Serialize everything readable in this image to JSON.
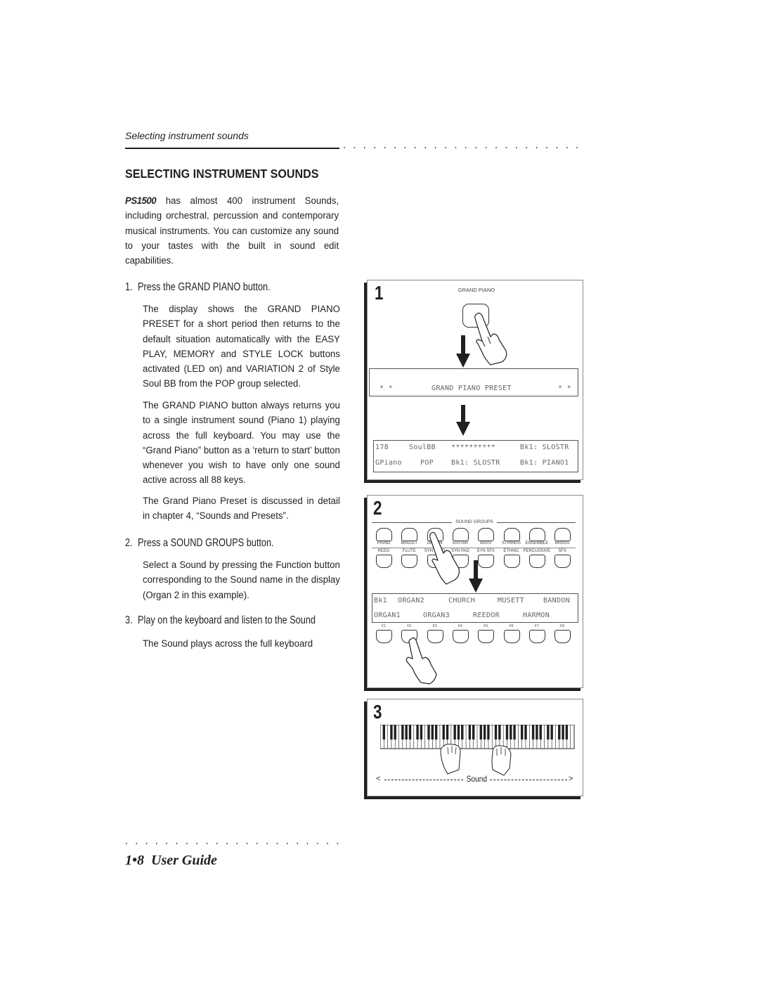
{
  "header": {
    "running_head": "Selecting instrument sounds"
  },
  "section": {
    "title": "SELECTING INSTRUMENT SOUNDS",
    "brand": "PS1500",
    "intro": " has almost 400 instrument Sounds, including orchestral, percussion and contemporary musical instruments.  You can customize any sound to your tastes with the built in sound edit capabilities."
  },
  "steps": [
    {
      "number": "1.",
      "title": "Press the GRAND PIANO button.",
      "paragraphs": [
        "The display shows the GRAND PIANO PRESET for a short period then returns to the default situation automatically with the EASY PLAY, MEMORY and STYLE LOCK buttons activated (LED on) and VARIATION 2 of Style Soul BB from the POP group selected.",
        "The GRAND PIANO button always returns you to a single instrument sound (Piano 1) playing across the full keyboard.  You may use the “Grand Piano” button as a ‘return to start’ button whenever you wish to have only one sound active across all 88 keys.",
        "The Grand Piano Preset is discussed in detail in chapter 4, “Sounds and Presets”."
      ]
    },
    {
      "number": "2.",
      "title": "Press a SOUND GROUPS button.",
      "paragraphs": [
        "Select a Sound by pressing the Function button corresponding to the Sound name in the display (Organ 2 in this example)."
      ]
    },
    {
      "number": "3.",
      "title": "Play on the keyboard and listen to the Sound",
      "paragraphs": [
        "The Sound plays across the full keyboard"
      ]
    }
  ],
  "figures": {
    "panel1": {
      "number": "1",
      "button_label": "GRAND PIANO",
      "lcd_preset": {
        "left": "* *",
        "center": "GRAND PIANO PRESET",
        "right": "* *"
      },
      "lcd_default": {
        "row1": [
          "178",
          "SoulBB",
          "**********",
          "Bk1: SLOSTR"
        ],
        "row2": [
          "GPiano",
          "POP",
          "Bk1: SLOSTR",
          "Bk1: PIANO1"
        ]
      }
    },
    "panel2": {
      "number": "2",
      "group_title": "SOUND GROUPS",
      "top_labels": [
        "PIANO",
        "MALLET",
        "ORGAN",
        "GUITAR",
        "BASS",
        "STRINGS",
        "ENSEMBLE",
        "BRASS"
      ],
      "bottom_labels": [
        "REED",
        "FLUTE",
        "SYN LEAD",
        "SYN PAD",
        "SYN SFX",
        "ETHNIC",
        "PERCUSSIVE",
        "SFX"
      ],
      "lcd": {
        "row1": [
          "Bk1",
          "ORGAN2",
          "CHURCH",
          "MUSETT",
          "BANDON"
        ],
        "row2": [
          "ORGAN1",
          "ORGAN3",
          "REEDOR",
          "HARMON"
        ]
      },
      "function_keys": [
        "F1",
        "F2",
        "F3",
        "F4",
        "F5",
        "F6",
        "F7",
        "F8"
      ]
    },
    "panel3": {
      "number": "3",
      "range_left": "<",
      "range_label": "Sound",
      "range_right": ">"
    }
  },
  "footer": {
    "page": "1•8",
    "title": "User Guide"
  }
}
